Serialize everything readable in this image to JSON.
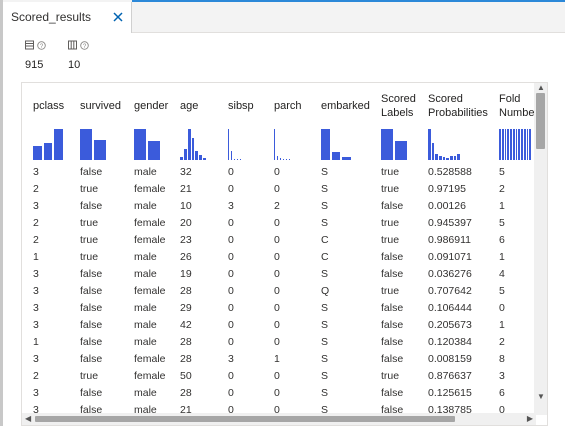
{
  "tab": {
    "label": "Scored_results",
    "close_icon": "close-icon"
  },
  "stats": [
    {
      "icon": "rows-icon",
      "value": "915"
    },
    {
      "icon": "columns-icon",
      "value": "10"
    }
  ],
  "colors": {
    "accent": "#2b88d8",
    "bars": "#3b5bdb",
    "close": "#0063b1"
  },
  "columns": [
    {
      "label": [
        "pclass"
      ],
      "hist": [
        0.45,
        0.55,
        1.0
      ]
    },
    {
      "label": [
        "survived"
      ],
      "hist": [
        1.0,
        0.65
      ]
    },
    {
      "label": [
        "gender"
      ],
      "hist": [
        1.0,
        0.6
      ]
    },
    {
      "label": [
        "age"
      ],
      "hist": [
        0.1,
        0.35,
        1.0,
        0.7,
        0.3,
        0.15,
        0.08
      ]
    },
    {
      "label": [
        "sibsp"
      ],
      "hist": [
        1.0,
        0.3,
        0.04,
        0.02,
        0.02
      ]
    },
    {
      "label": [
        "parch"
      ],
      "hist": [
        1.0,
        0.12,
        0.08,
        0.02,
        0.02,
        0.01
      ]
    },
    {
      "label": [
        "embarked"
      ],
      "hist": [
        1.0,
        0.25,
        0.1
      ]
    },
    {
      "label": [
        "Scored",
        "Labels"
      ],
      "hist": [
        1.0,
        0.62
      ]
    },
    {
      "label": [
        "Scored",
        "Probabilities"
      ],
      "hist": [
        1.0,
        0.55,
        0.2,
        0.12,
        0.1,
        0.08,
        0.12,
        0.14,
        0.18
      ]
    },
    {
      "label": [
        "Fold",
        "Number"
      ],
      "hist": [
        1,
        1,
        1,
        1,
        1,
        1,
        1,
        1,
        1,
        1,
        1,
        1
      ]
    }
  ],
  "rows": [
    [
      "3",
      "false",
      "male",
      "32",
      "0",
      "0",
      "S",
      "true",
      "0.528588",
      "5"
    ],
    [
      "2",
      "true",
      "female",
      "21",
      "0",
      "0",
      "S",
      "true",
      "0.97195",
      "2"
    ],
    [
      "3",
      "false",
      "male",
      "10",
      "3",
      "2",
      "S",
      "false",
      "0.00126",
      "1"
    ],
    [
      "2",
      "true",
      "female",
      "20",
      "0",
      "0",
      "S",
      "true",
      "0.945397",
      "5"
    ],
    [
      "2",
      "true",
      "female",
      "23",
      "0",
      "0",
      "C",
      "true",
      "0.986911",
      "6"
    ],
    [
      "1",
      "true",
      "male",
      "26",
      "0",
      "0",
      "C",
      "false",
      "0.091071",
      "1"
    ],
    [
      "3",
      "false",
      "male",
      "19",
      "0",
      "0",
      "S",
      "false",
      "0.036276",
      "4"
    ],
    [
      "3",
      "false",
      "female",
      "28",
      "0",
      "0",
      "Q",
      "true",
      "0.707642",
      "5"
    ],
    [
      "3",
      "false",
      "male",
      "29",
      "0",
      "0",
      "S",
      "false",
      "0.106444",
      "0"
    ],
    [
      "3",
      "false",
      "male",
      "42",
      "0",
      "0",
      "S",
      "false",
      "0.205673",
      "1"
    ],
    [
      "1",
      "false",
      "male",
      "28",
      "0",
      "0",
      "S",
      "false",
      "0.120384",
      "2"
    ],
    [
      "3",
      "false",
      "female",
      "28",
      "3",
      "1",
      "S",
      "false",
      "0.008159",
      "8"
    ],
    [
      "2",
      "true",
      "female",
      "50",
      "0",
      "0",
      "S",
      "true",
      "0.876637",
      "3"
    ],
    [
      "3",
      "false",
      "male",
      "28",
      "0",
      "0",
      "S",
      "false",
      "0.125615",
      "6"
    ],
    [
      "3",
      "false",
      "male",
      "21",
      "0",
      "0",
      "S",
      "false",
      "0.138785",
      "0"
    ]
  ]
}
